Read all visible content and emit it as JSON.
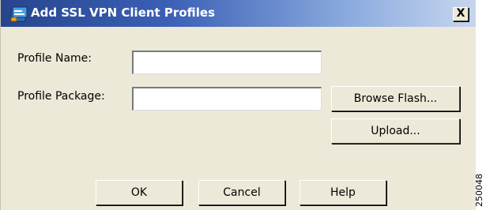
{
  "dialog": {
    "title": "Add SSL VPN Client Profiles",
    "close_label": "X",
    "icon": "cisco-asdm-app-icon"
  },
  "form": {
    "profile_name_label": "Profile Name:",
    "profile_name_value": "",
    "profile_package_label": "Profile Package:",
    "profile_package_value": ""
  },
  "buttons": {
    "browse_flash": "Browse Flash...",
    "upload": "Upload...",
    "ok": "OK",
    "cancel": "Cancel",
    "help": "Help"
  },
  "figure_id": "250048",
  "colors": {
    "titlebar_start": "#27458e",
    "titlebar_end": "#c7d6ee",
    "dialog_background": "#ece9d8"
  }
}
